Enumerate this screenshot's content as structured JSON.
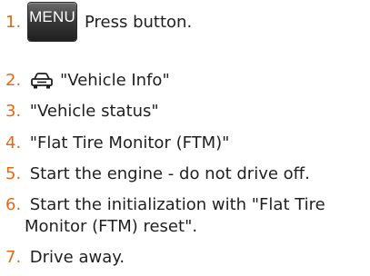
{
  "steps": [
    {
      "num": "1.",
      "text": "Press button."
    },
    {
      "num": "2.",
      "text": "\"Vehicle Info\""
    },
    {
      "num": "3.",
      "text": "\"Vehicle status\""
    },
    {
      "num": "4.",
      "text": "\"Flat Tire Monitor (FTM)\""
    },
    {
      "num": "5.",
      "text": "Start the engine - do not drive off."
    },
    {
      "num": "6.",
      "line1": "Start the initialization with \"Flat Tire",
      "line2": "Monitor (FTM) reset\"."
    },
    {
      "num": "7.",
      "text": "Drive away."
    }
  ],
  "menu_button_label": "MENU",
  "icons": {
    "step2": "car-icon"
  },
  "colors": {
    "step_number": "#e06a1a",
    "text": "#1f1f1f"
  }
}
